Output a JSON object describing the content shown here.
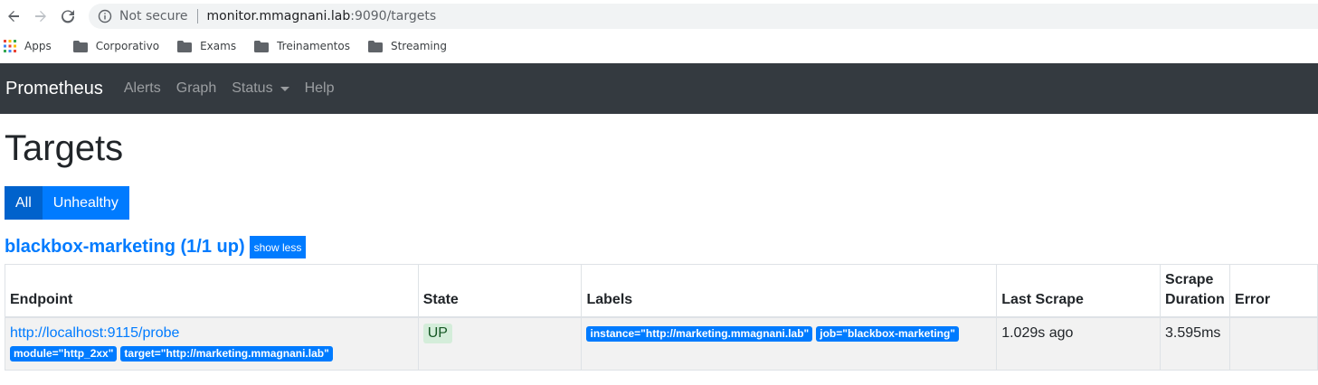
{
  "browser": {
    "security_text": "Not secure",
    "url_host": "monitor.mmagnani.lab",
    "url_path": ":9090/targets"
  },
  "bookmarks": [
    {
      "label": "Apps",
      "icon": "apps-grid-icon"
    },
    {
      "label": "Corporativo",
      "icon": "folder-icon"
    },
    {
      "label": "Exams",
      "icon": "folder-icon"
    },
    {
      "label": "Treinamentos",
      "icon": "folder-icon"
    },
    {
      "label": "Streaming",
      "icon": "folder-icon"
    }
  ],
  "navbar": {
    "brand": "Prometheus",
    "links": [
      "Alerts",
      "Graph",
      "Status",
      "Help"
    ]
  },
  "page": {
    "title": "Targets",
    "filters": [
      "All",
      "Unhealthy"
    ],
    "active_filter": "All"
  },
  "job": {
    "title": "blackbox-marketing (1/1 up)",
    "toggle_label": "show less"
  },
  "table": {
    "headers": [
      "Endpoint",
      "State",
      "Labels",
      "Last Scrape",
      "Scrape Duration",
      "Error"
    ],
    "row": {
      "endpoint": "http://localhost:9115/probe",
      "endpoint_params": [
        "module=\"http_2xx\"",
        "target=\"http://marketing.mmagnani.lab\""
      ],
      "state": "UP",
      "labels": [
        "instance=\"http://marketing.mmagnani.lab\"",
        "job=\"blackbox-marketing\""
      ],
      "last_scrape": "1.029s ago",
      "scrape_duration": "3.595ms",
      "error": ""
    }
  },
  "colors": {
    "navbar_bg": "#343a40",
    "primary": "#007bff",
    "state_up_bg": "#d4edda",
    "state_up_text": "#155724"
  }
}
